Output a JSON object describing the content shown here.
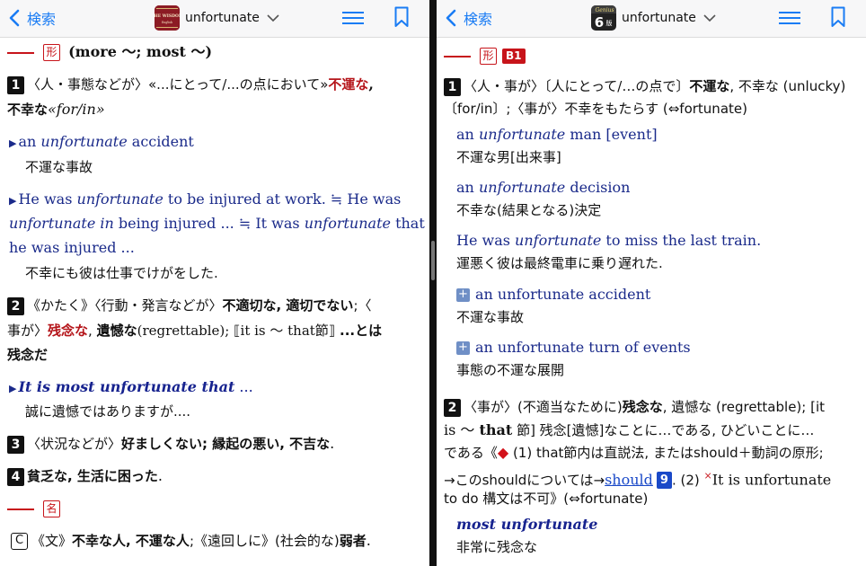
{
  "left": {
    "nav": {
      "back_label": "検索",
      "title": "unfortunate",
      "app_icon_text": "THE WISDOM"
    },
    "pos_adj": "形",
    "pos_noun": "名",
    "inflection": "(more ～; most ～)",
    "s1": {
      "num": "1",
      "l1a": "〈人・事態などが〉«...にとって/...の点において»",
      "l1b": "不運な",
      "l1c": ",",
      "l2a": "不幸な",
      "l2b": "«for/in»",
      "ex1_a": "an ",
      "ex1_b": "unfortunate",
      "ex1_c": " accident",
      "ex1_jp": "不運な事故",
      "ex2_l1a": "He was ",
      "ex2_l1b": "unfortunate",
      "ex2_l1c": " to be injured at work. ≒ He was",
      "ex2_l2a": "unfortunate in",
      "ex2_l2b": " being injured ... ≒ It was ",
      "ex2_l2c": "unfortunate",
      "ex2_l2d": " that",
      "ex2_l3": "he was injured ...",
      "ex2_jp": "不幸にも彼は仕事でけがをした."
    },
    "s2": {
      "num": "2",
      "l1a": "《かたく》〈行動・発言などが〉",
      "l1b": "不適切な, 適切でない",
      "l1c": ";〈",
      "l2a": "事が〉",
      "l2b": "残念な",
      "l2c": ", ",
      "l2d": "遺憾な",
      "l2e": "(regrettable); ⟦it is ～ that節⟧ ",
      "l2f": "...とは",
      "l3": "残念だ",
      "ex_a": "It is most unfortunate that",
      "ex_b": " ...",
      "ex_jp": "誠に遺憾ではありますが...."
    },
    "s3": {
      "num": "3",
      "a": "〈状況などが〉",
      "b": "好ましくない; 縁起の悪い, 不吉な",
      "c": "."
    },
    "s4": {
      "num": "4",
      "b": "貧乏な, 生活に困った",
      "c": "."
    },
    "noun": {
      "c_label": "C",
      "a": "《文》",
      "b": "不幸な人, 不運な人",
      "c": ";《遠回しに》(社会的な)",
      "d": "弱者",
      "e": "."
    }
  },
  "right": {
    "nav": {
      "back_label": "検索",
      "title": "unfortunate",
      "app_icon_text": "Genius 6 版"
    },
    "pos_adj": "形",
    "level": "B1",
    "s1": {
      "num": "1",
      "l1a": "〈人・事が〉〔人にとって/…の点で〕",
      "l1b": "不運な",
      "l1c": ", 不幸な (unlucky)",
      "l2": "〔for/in〕;〈事が〉不幸をもたらす (⇔fortunate)",
      "ex": [
        {
          "a": "an ",
          "b": "unfortunate",
          "c": " man [event]",
          "jp": "不運な男[出来事]"
        },
        {
          "a": "an ",
          "b": "unfortunate",
          "c": " decision",
          "jp": "不幸な(結果となる)決定"
        },
        {
          "a": "He was ",
          "b": "unfortunate",
          "c": " to miss the last train.",
          "jp": "運悪く彼は最終電車に乗り遅れた."
        }
      ],
      "plus_ex": [
        {
          "en": "an unfortunate accident",
          "jp": "不運な事故"
        },
        {
          "en": "an unfortunate turn of events",
          "jp": "事態の不運な展開"
        }
      ]
    },
    "s2": {
      "num": "2",
      "l1a": "〈事が〉(不適当なために)",
      "l1b": "残念な",
      "l1c": ", 遺憾な (regrettable); [it",
      "l2a": "is ～ ",
      "l2b": "that",
      "l2c": " 節] 残念[遺憾]なことに…である, ひどいことに…",
      "l3a": "である《",
      "l3b": "◆",
      "l3c": " (1) that節内は直説法, またはshould＋動詞の原形;",
      "l4a": "→このshouldについては→",
      "l4b": "should",
      "l4c": "9",
      "l4d": ". (2) ",
      "l4e": "×",
      "l4f": "It is unfortunate",
      "l5": "to do 構文は不可》(⇔fortunate)",
      "ex_en": "most unfortunate",
      "ex_jp": "非常に残念な"
    }
  }
}
